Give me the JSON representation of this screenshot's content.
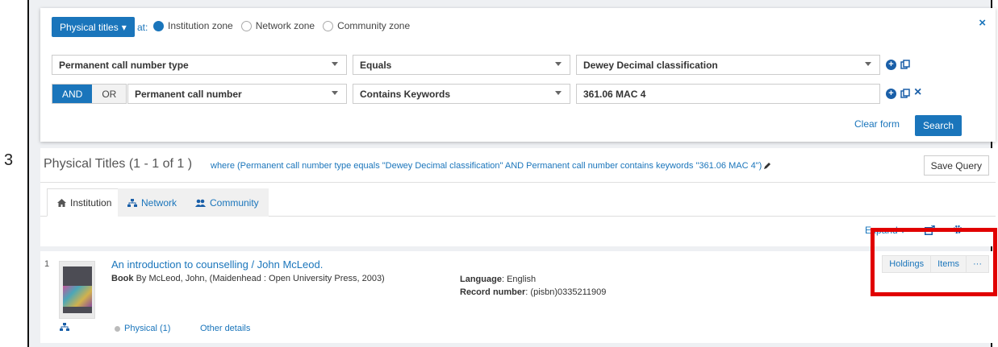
{
  "step_number": "3",
  "search": {
    "scope_label": "Physical titles",
    "scope_caret": "▾",
    "at_label": "at:",
    "zones": [
      "Institution zone",
      "Network zone",
      "Community zone"
    ],
    "selected_zone": "Institution zone",
    "row1": {
      "field": "Permanent call number type",
      "operator": "Equals",
      "value": "Dewey Decimal classification"
    },
    "row2": {
      "and": "AND",
      "or": "OR",
      "field": "Permanent call number",
      "operator": "Contains Keywords",
      "value": "361.06 MAC 4"
    },
    "clear_form": "Clear form",
    "search_button": "Search",
    "close": "×"
  },
  "results": {
    "title": "Physical Titles (1 - 1 of 1 )",
    "query": "where (Permanent call number type equals \"Dewey Decimal classification\" AND Permanent call number contains keywords \"361.06 MAC 4\")",
    "save_query": "Save Query"
  },
  "tabs": [
    {
      "label": "Institution",
      "icon": "home-icon",
      "active": true
    },
    {
      "label": "Network",
      "icon": "network-icon",
      "active": false
    },
    {
      "label": "Community",
      "icon": "users-icon",
      "active": false
    }
  ],
  "toolbar": {
    "expand": "Expand ▾"
  },
  "record": {
    "number": "1",
    "title": "An introduction to counselling / John McLeod.",
    "type": "Book",
    "by": "By McLeod, John, (Maidenhead : Open University Press, 2003)",
    "language_label": "Language",
    "language": ": English",
    "record_label": "Record number",
    "record_value": ": (pisbn)0335211909",
    "physical": "Physical (1)",
    "other_details": "Other details",
    "actions": [
      "Holdings",
      "Items",
      "···"
    ]
  },
  "colors": {
    "accent": "#1a75bb",
    "highlight": "#e10000"
  }
}
